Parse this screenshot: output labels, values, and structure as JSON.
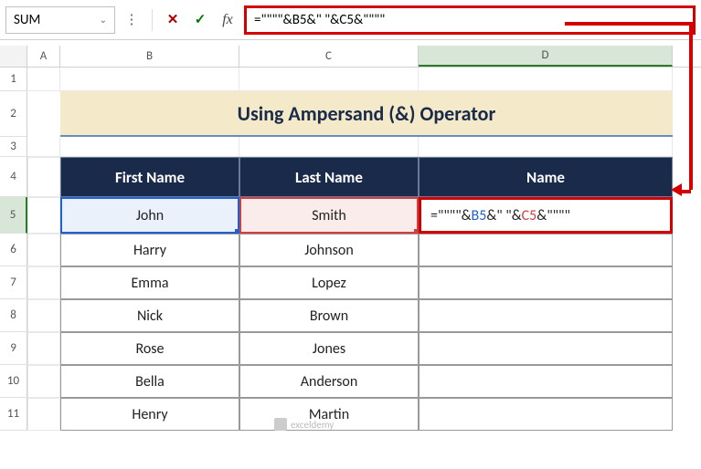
{
  "name_box": "SUM",
  "formula": "=\"\"\"\"&B5&\" \"&C5&\"\"\"\"",
  "columns": [
    "A",
    "B",
    "C",
    "D"
  ],
  "rows": [
    "1",
    "2",
    "3",
    "4",
    "5",
    "6",
    "7",
    "8",
    "9",
    "10",
    "11"
  ],
  "title": "Using Ampersand (&) Operator",
  "headers": {
    "b": "First Name",
    "c": "Last Name",
    "d": "Name"
  },
  "data": [
    {
      "first": "John",
      "last": "Smith"
    },
    {
      "first": "Harry",
      "last": "Johnson"
    },
    {
      "first": "Emma",
      "last": "Lopez"
    },
    {
      "first": "Nick",
      "last": "Brown"
    },
    {
      "first": "Rose",
      "last": "Jones"
    },
    {
      "first": "Bella",
      "last": "Anderson"
    },
    {
      "first": "Henry",
      "last": "Martin"
    }
  ],
  "d5_formula": {
    "p1": "=\"\"\"\"&",
    "ref1": "B5",
    "p2": "&\" \"&",
    "ref2": "C5",
    "p3": "&\"\"\"\""
  },
  "icons": {
    "chevron": "⌄",
    "cancel": "✕",
    "enter": "✓",
    "fx": "fx",
    "dots": "⋮"
  },
  "watermark": "exceldemy"
}
